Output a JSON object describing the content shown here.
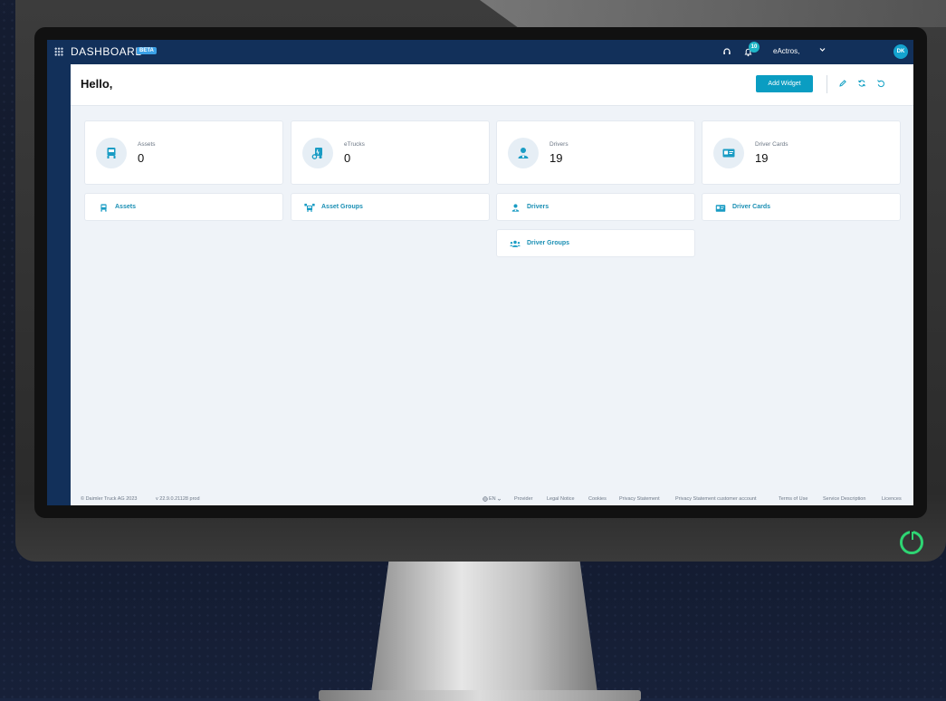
{
  "topbar": {
    "brand": "DASHBOARD",
    "beta": "BETA",
    "notification_count": "10",
    "user_name": "eActros,",
    "avatar_initials": "DK"
  },
  "header": {
    "greeting": "Hello,",
    "add_widget_label": "Add Widget"
  },
  "stats": [
    {
      "label": "Assets",
      "value": "0",
      "icon": "truck-icon"
    },
    {
      "label": "eTrucks",
      "value": "0",
      "icon": "etruck-icon"
    },
    {
      "label": "Drivers",
      "value": "19",
      "icon": "driver-icon"
    },
    {
      "label": "Driver Cards",
      "value": "19",
      "icon": "id-card-icon"
    }
  ],
  "links": [
    {
      "label": "Assets",
      "icon": "truck-icon"
    },
    {
      "label": "Asset Groups",
      "icon": "truck-group-icon"
    },
    {
      "label": "Drivers",
      "icon": "driver-icon"
    },
    {
      "label": "Driver Cards",
      "icon": "id-card-icon"
    },
    {
      "label": "Driver Groups",
      "icon": "driver-group-icon"
    }
  ],
  "footer": {
    "copyright": "© Daimler Truck AG 2023",
    "version": "v 22.9.0.21128 prod",
    "language": "EN",
    "links": [
      "Provider",
      "Legal Notice",
      "Cookies",
      "Privacy Statement",
      "Privacy Statement customer account",
      "Terms of Use",
      "Service Description",
      "Licences"
    ]
  },
  "colors": {
    "topbar": "#12305a",
    "accent": "#0a9dc2",
    "page_background": "#eff3f8",
    "power_led": "#2ed573"
  }
}
